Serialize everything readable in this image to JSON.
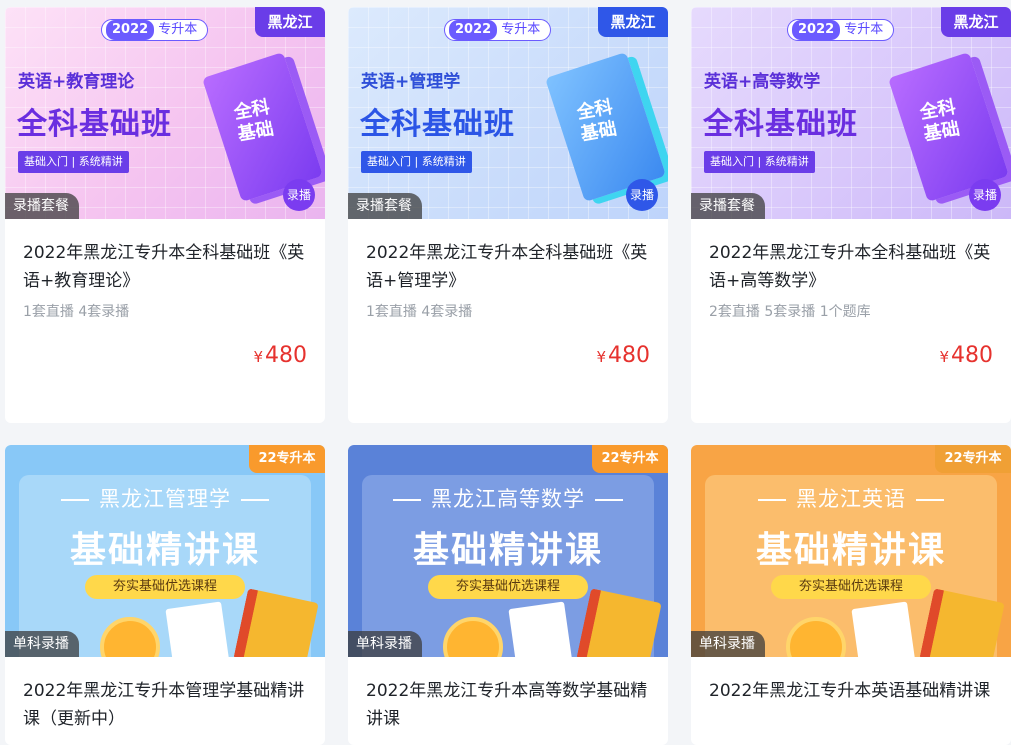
{
  "courses": [
    {
      "cover": {
        "year": "2022",
        "label": "专升本",
        "region": "黑龙江",
        "subject": "英语+教育理论",
        "title": "全科基础班",
        "sub": "基础入门 | 系统精讲",
        "book": "全科\n基础",
        "rec": "录播",
        "badge": "录播套餐"
      },
      "title": "2022年黑龙江专升本全科基础班《英语+教育理论》",
      "meta": "1套直播 4套录播",
      "price": "480",
      "currency": "¥"
    },
    {
      "cover": {
        "year": "2022",
        "label": "专升本",
        "region": "黑龙江",
        "subject": "英语+管理学",
        "title": "全科基础班",
        "sub": "基础入门 | 系统精讲",
        "book": "全科\n基础",
        "rec": "录播",
        "badge": "录播套餐"
      },
      "title": "2022年黑龙江专升本全科基础班《英语+管理学》",
      "meta": "1套直播 4套录播",
      "price": "480",
      "currency": "¥"
    },
    {
      "cover": {
        "year": "2022",
        "label": "专升本",
        "region": "黑龙江",
        "subject": "英语+高等数学",
        "title": "全科基础班",
        "sub": "基础入门 | 系统精讲",
        "book": "全科\n基础",
        "rec": "录播",
        "badge": "录播套餐"
      },
      "title": "2022年黑龙江专升本全科基础班《英语+高等数学》",
      "meta": "2套直播 5套录播 1个题库",
      "price": "480",
      "currency": "¥"
    },
    {
      "cover": {
        "tag": "22专升本",
        "headline": "黑龙江管理学",
        "big": "基础精讲课",
        "strip": "夯实基础优选课程",
        "badge": "单科录播"
      },
      "title": "2022年黑龙江专升本管理学基础精讲课（更新中）"
    },
    {
      "cover": {
        "tag": "22专升本",
        "headline": "黑龙江高等数学",
        "big": "基础精讲课",
        "strip": "夯实基础优选课程",
        "badge": "单科录播"
      },
      "title": "2022年黑龙江专升本高等数学基础精讲课"
    },
    {
      "cover": {
        "tag": "22专升本",
        "headline": "黑龙江英语",
        "big": "基础精讲课",
        "strip": "夯实基础优选课程",
        "badge": "单科录播"
      },
      "title": "2022年黑龙江专升本英语基础精讲课"
    }
  ]
}
